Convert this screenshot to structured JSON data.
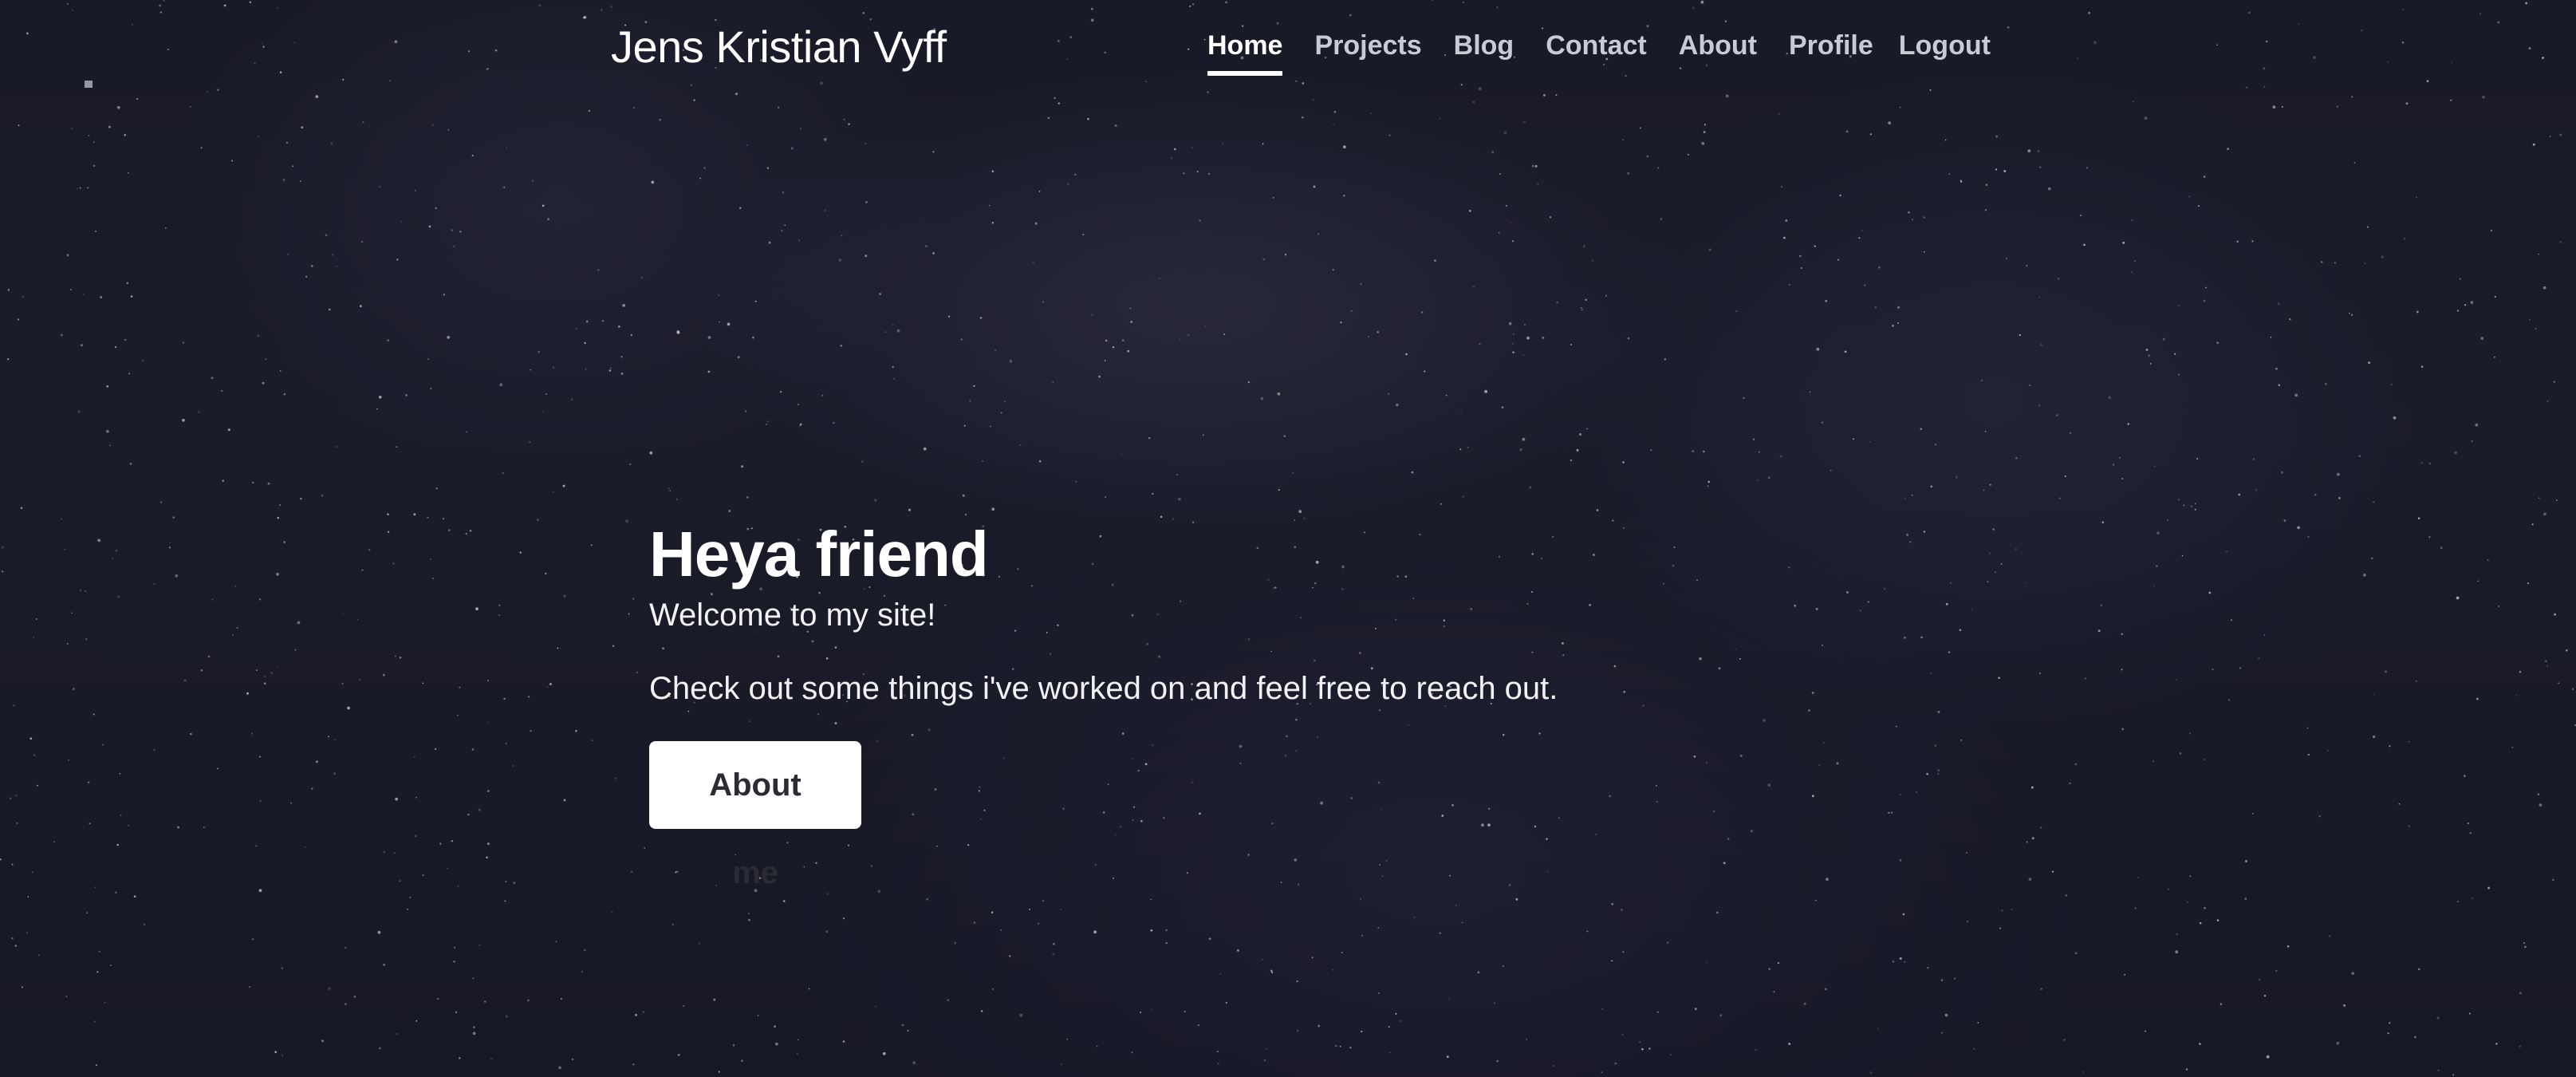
{
  "site": {
    "brand": "Jens Kristian Vyff"
  },
  "nav": {
    "items": [
      {
        "label": "Home",
        "active": true
      },
      {
        "label": "Projects",
        "active": false
      },
      {
        "label": "Blog",
        "active": false
      },
      {
        "label": "Contact",
        "active": false
      },
      {
        "label": "About",
        "active": false
      },
      {
        "label": "Profile",
        "active": false
      },
      {
        "label": "Logout",
        "active": false
      }
    ]
  },
  "hero": {
    "title": "Heya friend",
    "welcome": "Welcome to my site!",
    "blurb": "Check out some things i've worked on and feel free to reach out.",
    "button_label": "About me"
  },
  "colors": {
    "background": "#1a1b28",
    "text": "#ffffff",
    "nav_inactive": "#c9cad3",
    "button_bg": "#ffffff",
    "button_text": "#2b2b33"
  }
}
